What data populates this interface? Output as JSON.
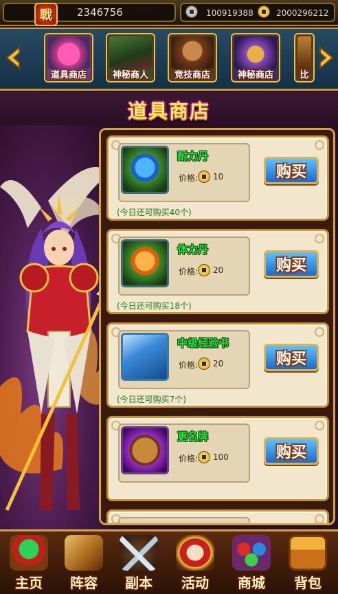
{
  "topbar": {
    "power_badge": "戰",
    "power_value": "2346756",
    "silver_value": "100919388",
    "gold_value": "2000296212"
  },
  "tabs": [
    {
      "label": "道具商店",
      "icon": "gift-box-icon"
    },
    {
      "label": "神秘商人",
      "icon": "mystery-merchant-icon"
    },
    {
      "label": "竞技商店",
      "icon": "arena-shop-icon"
    },
    {
      "label": "神秘商店",
      "icon": "treasure-chest-icon"
    },
    {
      "label": "比",
      "icon": "partial-tab-icon"
    }
  ],
  "page_title": "道具商店",
  "goods": [
    {
      "name": "耐力丹",
      "price_label": "价格:",
      "price": "10",
      "limit": "(今日还可购买40个)",
      "buy_label": "购买",
      "icon": "blue-pill-icon"
    },
    {
      "name": "体力丹",
      "price_label": "价格:",
      "price": "20",
      "limit": "(今日还可购买18个)",
      "buy_label": "购买",
      "icon": "orange-pill-icon"
    },
    {
      "name": "中级经验书",
      "price_label": "价格:",
      "price": "20",
      "limit": "(今日还可购买7个)",
      "buy_label": "购买",
      "icon": "exp-book-icon"
    },
    {
      "name": "更名牌",
      "price_label": "价格:",
      "price": "100",
      "limit": "",
      "buy_label": "购买",
      "icon": "rename-card-icon"
    }
  ],
  "nav": [
    {
      "label": "主页",
      "icon": "home-pagoda-icon"
    },
    {
      "label": "阵容",
      "icon": "lineup-scroll-icon"
    },
    {
      "label": "副本",
      "icon": "crossed-swords-icon"
    },
    {
      "label": "活动",
      "icon": "drum-icon"
    },
    {
      "label": "商城",
      "icon": "gems-icon"
    },
    {
      "label": "背包",
      "icon": "backpack-chest-icon"
    }
  ],
  "colors": {
    "item_name": "#24e83a",
    "limit_text": "#1a7a1a",
    "title_gold": "#ffe97a",
    "panel_border": "#d4a44a"
  }
}
